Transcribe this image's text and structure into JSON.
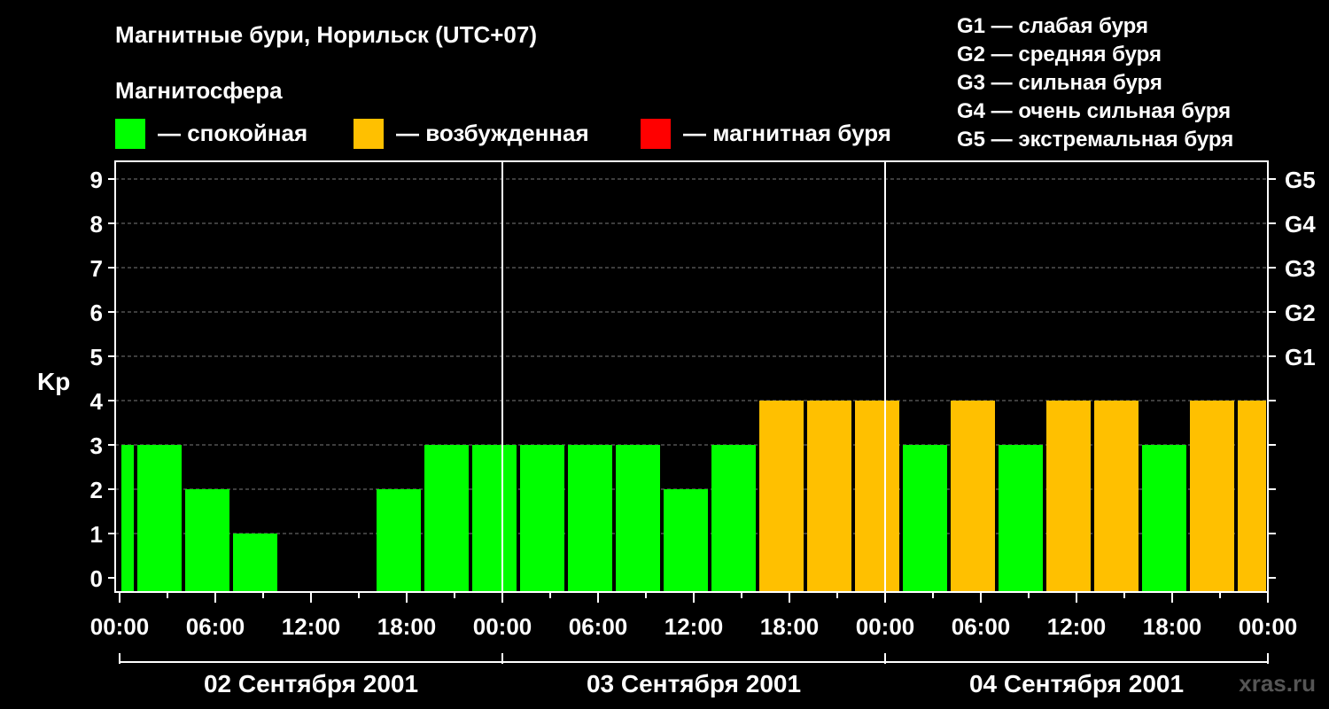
{
  "header": {
    "title": "Магнитные бури, Норильск (UTC+07)",
    "subtitle": "Магнитосфера"
  },
  "legend": [
    {
      "label": "— спокойная",
      "color": "#00ff00"
    },
    {
      "label": "— возбужденная",
      "color": "#ffc000"
    },
    {
      "label": "— магнитная буря",
      "color": "#ff0000"
    }
  ],
  "g_levels": [
    "G1 — слабая буря",
    "G2 — средняя буря",
    "G3 — сильная буря",
    "G4 — очень сильная буря",
    "G5 — экстремальная буря"
  ],
  "watermark": "xras.ru",
  "chart_data": {
    "type": "bar",
    "ylabel": "Kp",
    "ylim": [
      0,
      9
    ],
    "yticks": [
      "0",
      "1",
      "2",
      "3",
      "4",
      "5",
      "6",
      "7",
      "8",
      "9"
    ],
    "right_ticks": [
      {
        "kp": 5,
        "label": "G1"
      },
      {
        "kp": 6,
        "label": "G2"
      },
      {
        "kp": 7,
        "label": "G3"
      },
      {
        "kp": 8,
        "label": "G4"
      },
      {
        "kp": 9,
        "label": "G5"
      }
    ],
    "x_hours_range": [
      0,
      72
    ],
    "xticks": [
      "00:00",
      "06:00",
      "12:00",
      "18:00",
      "00:00",
      "06:00",
      "12:00",
      "18:00",
      "00:00",
      "06:00",
      "12:00",
      "18:00",
      "00:00"
    ],
    "days": [
      "02 Сентября 2001",
      "03 Сентября 2001",
      "04 Сентября 2001"
    ],
    "grid": true,
    "bars": [
      {
        "start_hour": 0,
        "end_hour": 1,
        "kp": 3,
        "color": "#00ff00"
      },
      {
        "start_hour": 1,
        "end_hour": 4,
        "kp": 3,
        "color": "#00ff00"
      },
      {
        "start_hour": 4,
        "end_hour": 7,
        "kp": 2,
        "color": "#00ff00"
      },
      {
        "start_hour": 7,
        "end_hour": 10,
        "kp": 1,
        "color": "#00ff00"
      },
      {
        "start_hour": 16,
        "end_hour": 19,
        "kp": 2,
        "color": "#00ff00"
      },
      {
        "start_hour": 19,
        "end_hour": 22,
        "kp": 3,
        "color": "#00ff00"
      },
      {
        "start_hour": 22,
        "end_hour": 25,
        "kp": 3,
        "color": "#00ff00"
      },
      {
        "start_hour": 25,
        "end_hour": 28,
        "kp": 3,
        "color": "#00ff00"
      },
      {
        "start_hour": 28,
        "end_hour": 31,
        "kp": 3,
        "color": "#00ff00"
      },
      {
        "start_hour": 31,
        "end_hour": 34,
        "kp": 3,
        "color": "#00ff00"
      },
      {
        "start_hour": 34,
        "end_hour": 37,
        "kp": 2,
        "color": "#00ff00"
      },
      {
        "start_hour": 37,
        "end_hour": 40,
        "kp": 3,
        "color": "#00ff00"
      },
      {
        "start_hour": 40,
        "end_hour": 43,
        "kp": 4,
        "color": "#ffc000"
      },
      {
        "start_hour": 43,
        "end_hour": 46,
        "kp": 4,
        "color": "#ffc000"
      },
      {
        "start_hour": 46,
        "end_hour": 49,
        "kp": 4,
        "color": "#ffc000"
      },
      {
        "start_hour": 49,
        "end_hour": 52,
        "kp": 3,
        "color": "#00ff00"
      },
      {
        "start_hour": 52,
        "end_hour": 55,
        "kp": 4,
        "color": "#ffc000"
      },
      {
        "start_hour": 55,
        "end_hour": 58,
        "kp": 3,
        "color": "#00ff00"
      },
      {
        "start_hour": 58,
        "end_hour": 61,
        "kp": 4,
        "color": "#ffc000"
      },
      {
        "start_hour": 61,
        "end_hour": 64,
        "kp": 4,
        "color": "#ffc000"
      },
      {
        "start_hour": 64,
        "end_hour": 67,
        "kp": 3,
        "color": "#00ff00"
      },
      {
        "start_hour": 67,
        "end_hour": 70,
        "kp": 4,
        "color": "#ffc000"
      },
      {
        "start_hour": 70,
        "end_hour": 72,
        "kp": 4,
        "color": "#ffc000"
      }
    ]
  }
}
